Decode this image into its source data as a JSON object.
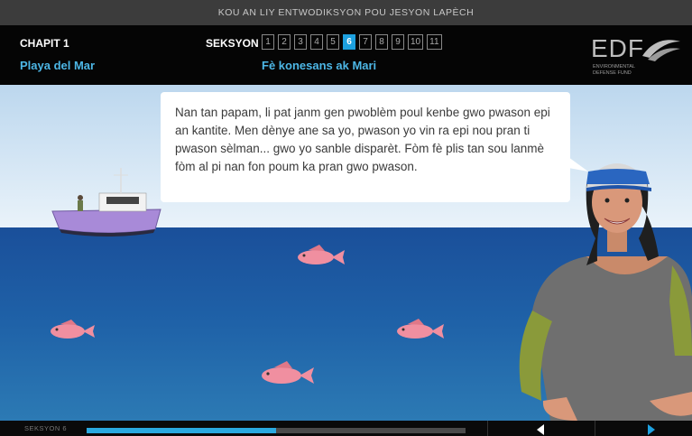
{
  "topbar": {
    "title": "KOU AN LIY ENTWODIKSYON POU JESYON LAPÈCH"
  },
  "chapter": {
    "label": "CHAPIT 1",
    "title": "Playa del Mar"
  },
  "section": {
    "label": "SEKSYON",
    "title": "Fè konesans ak Mari",
    "items": [
      "1",
      "2",
      "3",
      "4",
      "5",
      "6",
      "7",
      "8",
      "9",
      "10",
      "11"
    ],
    "active": "6"
  },
  "logo": {
    "text": "EDF",
    "sub1": "ENVIRONMENTAL",
    "sub2": "DEFENSE FUND"
  },
  "bubble": {
    "text": "Nan tan papam, li pat janm gen pwoblèm poul  kenbe gwo pwason epi an kantite. Men dènye ane sa yo, pwason yo vin ra epi nou pran ti pwason sèlman... gwo yo sanble disparèt. Fòm fè plis tan sou lanmè  fòm al pi nan fon poum ka pran gwo pwason."
  },
  "footer": {
    "label": "SEKSYON 6",
    "progress": 0.5
  },
  "icons": {
    "prev": "triangle-left-icon",
    "next": "triangle-right-icon"
  },
  "colors": {
    "accent": "#1da1e0",
    "title_blue": "#4db7e6"
  }
}
